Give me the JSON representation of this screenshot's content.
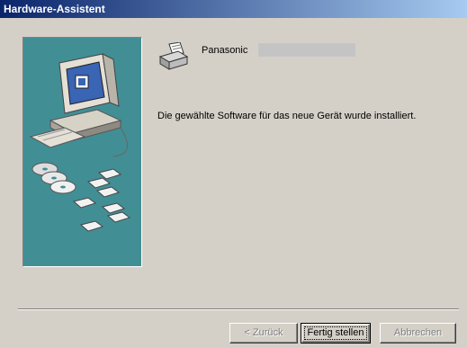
{
  "window": {
    "title": "Hardware-Assistent"
  },
  "device": {
    "icon": "printer-icon",
    "name": "Panasonic"
  },
  "message": "Die gewählte Software für das neue Gerät wurde installiert.",
  "buttons": {
    "back": "< Zurück",
    "finish": "Fertig stellen",
    "cancel": "Abbrechen"
  },
  "colors": {
    "titlebar_start": "#0a246a",
    "titlebar_end": "#a6caf0",
    "panel": "#428e95",
    "face": "#d4d0c8"
  }
}
